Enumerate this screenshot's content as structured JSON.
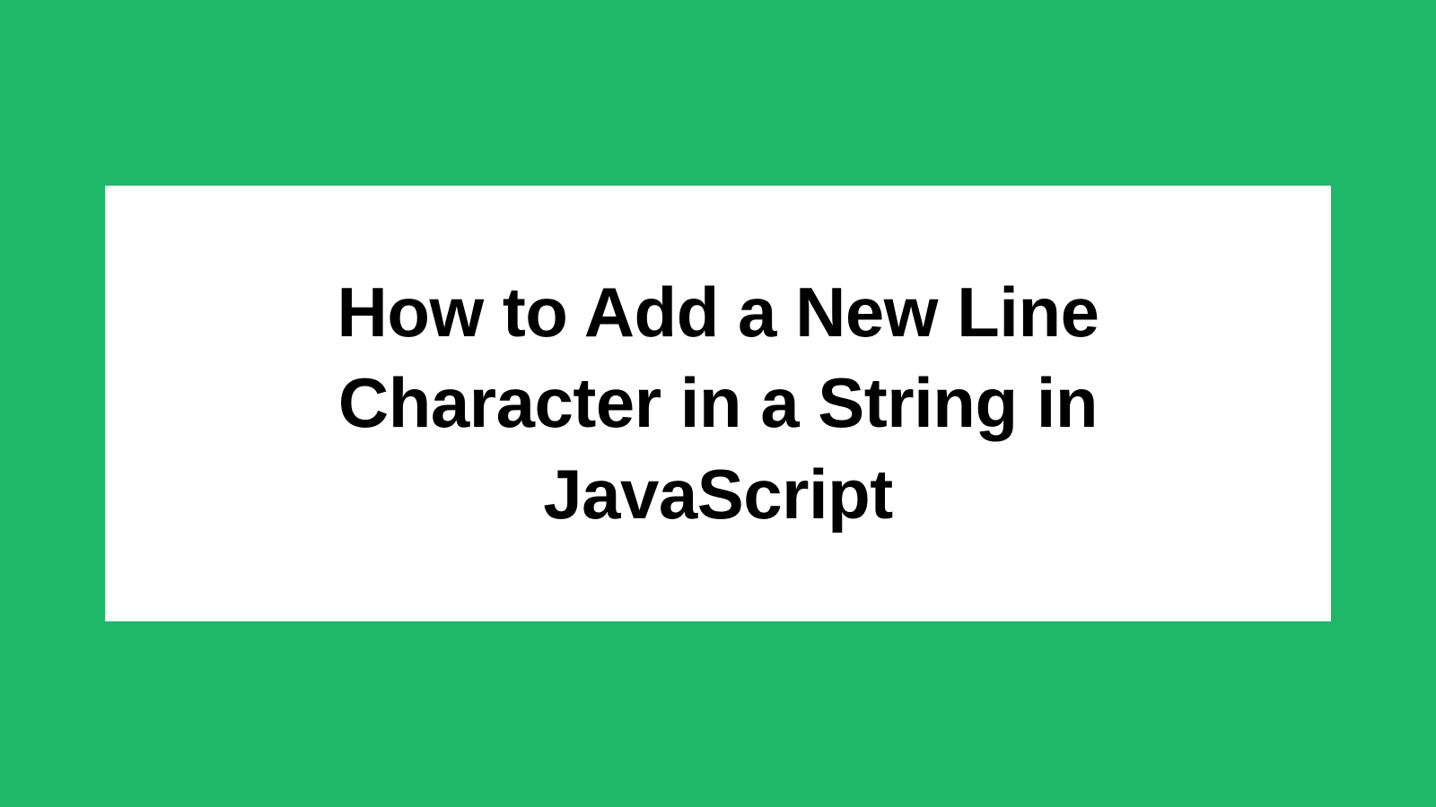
{
  "card": {
    "title": "How to Add a New Line Character in a String in JavaScript"
  },
  "colors": {
    "background": "#1fb768",
    "card": "#ffffff",
    "text": "#000000"
  }
}
